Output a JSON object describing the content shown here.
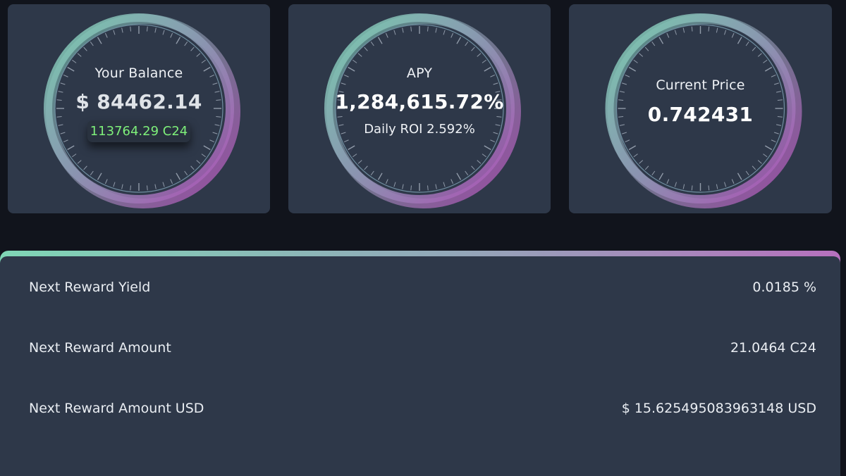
{
  "cards": [
    {
      "label": "Your Balance",
      "value": "$ 84462.14",
      "sub": "113764.29 C24"
    },
    {
      "label": "APY",
      "value": "1,284,615.72%",
      "sub": "Daily ROI 2.592%"
    },
    {
      "label": "Current Price",
      "value": "0.742431"
    }
  ],
  "rewards": [
    {
      "label": "Next Reward Yield",
      "value": "0.0185 %"
    },
    {
      "label": "Next Reward Amount",
      "value": "21.0464 C24"
    },
    {
      "label": "Next Reward Amount USD",
      "value": "$ 15.625495083963148 USD"
    }
  ],
  "colors": {
    "background": "#11141c",
    "card": "#2e3849",
    "ring_teal": "#7fd6b6",
    "ring_magenta": "#b04fb8",
    "balance_green": "#7ef07a"
  }
}
